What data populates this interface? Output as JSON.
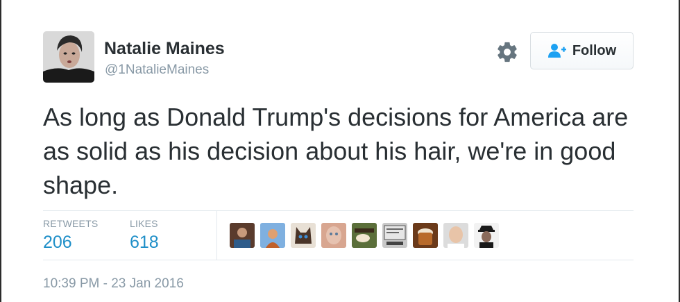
{
  "author": {
    "name": "Natalie Maines",
    "handle": "@1NatalieMaines",
    "avatar_icon": "profile-photo"
  },
  "actions": {
    "follow_label": "Follow",
    "follow_icon": "add-user-icon",
    "settings_icon": "gear-icon"
  },
  "tweet": {
    "text": "As long as Donald Trump's decisions for America are as solid as his decision about his hair, we're in good shape."
  },
  "stats": {
    "retweets_label": "RETWEETS",
    "retweets_value": "206",
    "likes_label": "LIKES",
    "likes_value": "618"
  },
  "likers": [
    {
      "name": "liker-avatar-1"
    },
    {
      "name": "liker-avatar-2"
    },
    {
      "name": "liker-avatar-3"
    },
    {
      "name": "liker-avatar-4"
    },
    {
      "name": "liker-avatar-5"
    },
    {
      "name": "liker-avatar-6"
    },
    {
      "name": "liker-avatar-7"
    },
    {
      "name": "liker-avatar-8"
    },
    {
      "name": "liker-avatar-9"
    }
  ],
  "timestamp": "10:39 PM - 23 Jan 2016",
  "colors": {
    "text": "#292f33",
    "muted": "#8899a6",
    "stat_value": "#1f8fc8",
    "follow_icon": "#1da1f2",
    "divider": "#e1e8ed"
  }
}
